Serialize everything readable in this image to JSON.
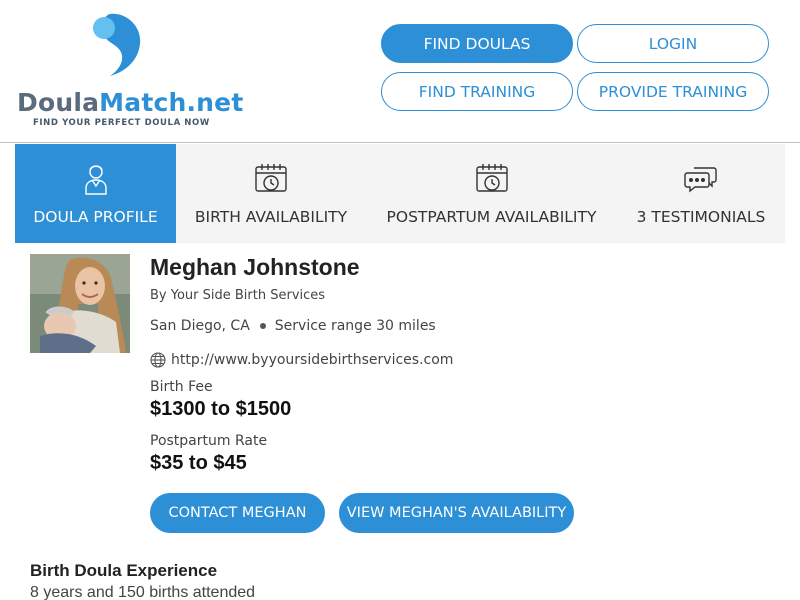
{
  "brand": {
    "name_part1": "Doula",
    "name_part2": "Match.net",
    "tagline": "FIND YOUR PERFECT DOULA NOW",
    "primary_color": "#2d8fd5",
    "secondary_color": "#5a6b7b"
  },
  "nav": {
    "find_doulas": "FIND DOULAS",
    "login": "LOGIN",
    "find_training": "FIND TRAINING",
    "provide_training": "PROVIDE TRAINING"
  },
  "tabs": [
    {
      "label": "DOULA PROFILE",
      "icon": "doula-person-icon",
      "active": true
    },
    {
      "label": "BIRTH AVAILABILITY",
      "icon": "calendar-clock-icon",
      "active": false
    },
    {
      "label": "POSTPARTUM AVAILABILITY",
      "icon": "calendar-clock-icon",
      "active": false
    },
    {
      "label": "3 TESTIMONIALS",
      "icon": "chat-bubbles-icon",
      "active": false
    }
  ],
  "profile": {
    "name": "Meghan Johnstone",
    "agency": "By Your Side Birth Services",
    "city": "San Diego, CA",
    "service_range": "Service range 30 miles",
    "website": "http://www.byyoursidebirthservices.com",
    "birth_fee_label": "Birth Fee",
    "birth_fee": "$1300 to $1500",
    "postpartum_label": "Postpartum Rate",
    "postpartum_rate": "$35 to $45",
    "contact_button": "CONTACT MEGHAN",
    "availability_button": "VIEW MEGHAN'S AVAILABILITY"
  },
  "experience": {
    "title": "Birth Doula Experience",
    "text": "8 years and 150 births attended"
  }
}
